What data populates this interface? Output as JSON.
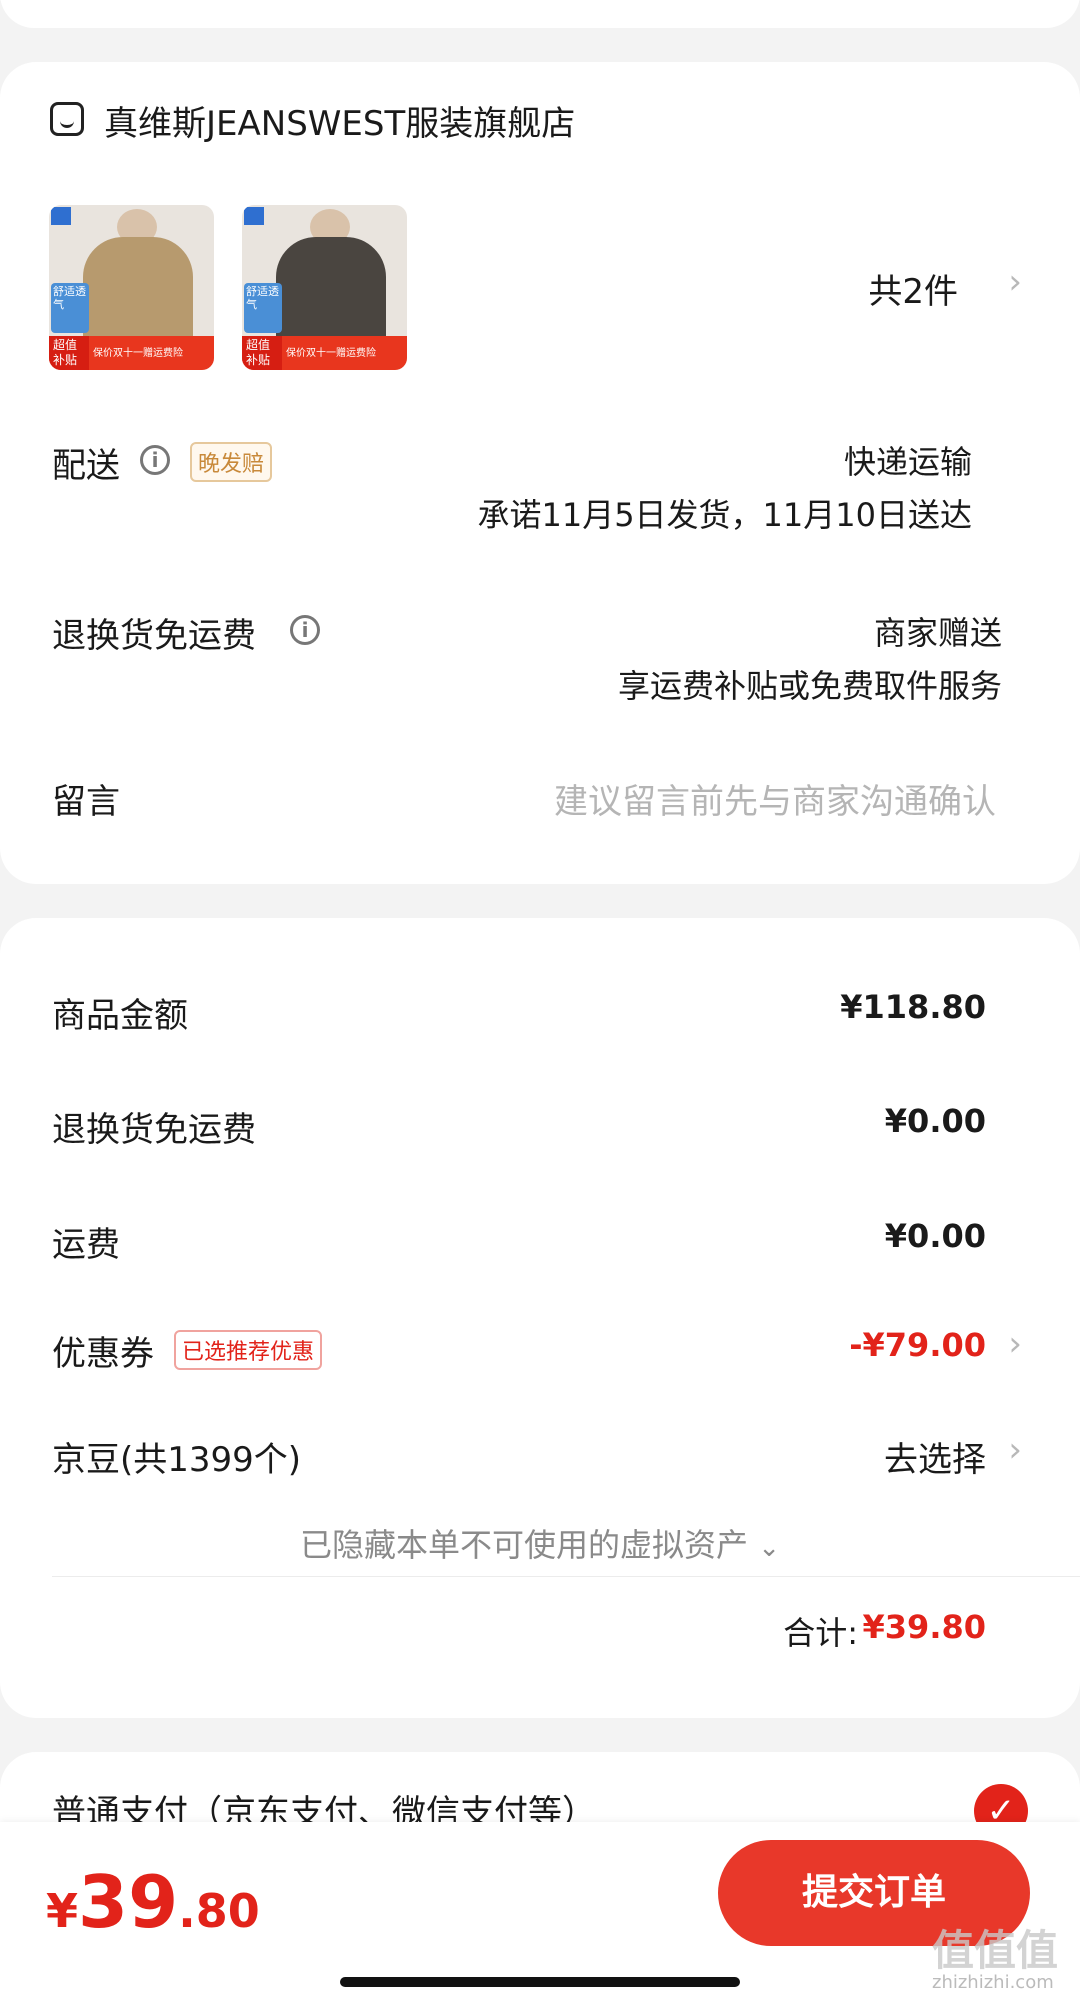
{
  "store": {
    "name": "真维斯JEANSWEST服装旗舰店",
    "item_count": "共2件",
    "products": [
      {
        "tag": "舒适透气",
        "band_label": "超值补贴",
        "band_text": "保价双十一赠运费险",
        "color": "#b79a6e"
      },
      {
        "tag": "舒适透气",
        "band_label": "超值补贴",
        "band_text": "保价双十一赠运费险",
        "color": "#4a4540"
      }
    ]
  },
  "delivery": {
    "label": "配送",
    "badge": "晚发赔",
    "method": "快递运输",
    "promise": "承诺11月5日发货，11月10日送达"
  },
  "return_shipping": {
    "label": "退换货免运费",
    "value": "商家赠送",
    "desc": "享运费补贴或免费取件服务"
  },
  "message": {
    "label": "留言",
    "placeholder": "建议留言前先与商家沟通确认"
  },
  "summary": {
    "goods_label": "商品金额",
    "goods_value": "¥118.80",
    "return_label": "退换货免运费",
    "return_value": "¥0.00",
    "shipping_label": "运费",
    "shipping_value": "¥0.00",
    "coupon_label": "优惠券",
    "coupon_badge": "已选推荐优惠",
    "coupon_value": "-¥79.00",
    "beans_label": "京豆(共1399个)",
    "beans_value": "去选择",
    "hidden_assets": "已隐藏本单不可使用的虚拟资产",
    "total_label": "合计:",
    "total_value": "¥39.80"
  },
  "payment": {
    "label": "普通支付（京东支付、微信支付等）"
  },
  "footer": {
    "currency": "¥",
    "price_int": "39",
    "price_dec": ".80",
    "submit_label": "提交订单"
  },
  "watermark": {
    "main": "值值值",
    "site": "zhizhizhi.com"
  },
  "colors": {
    "accent": "#e2231a",
    "badge_orange": "#c8893a"
  }
}
